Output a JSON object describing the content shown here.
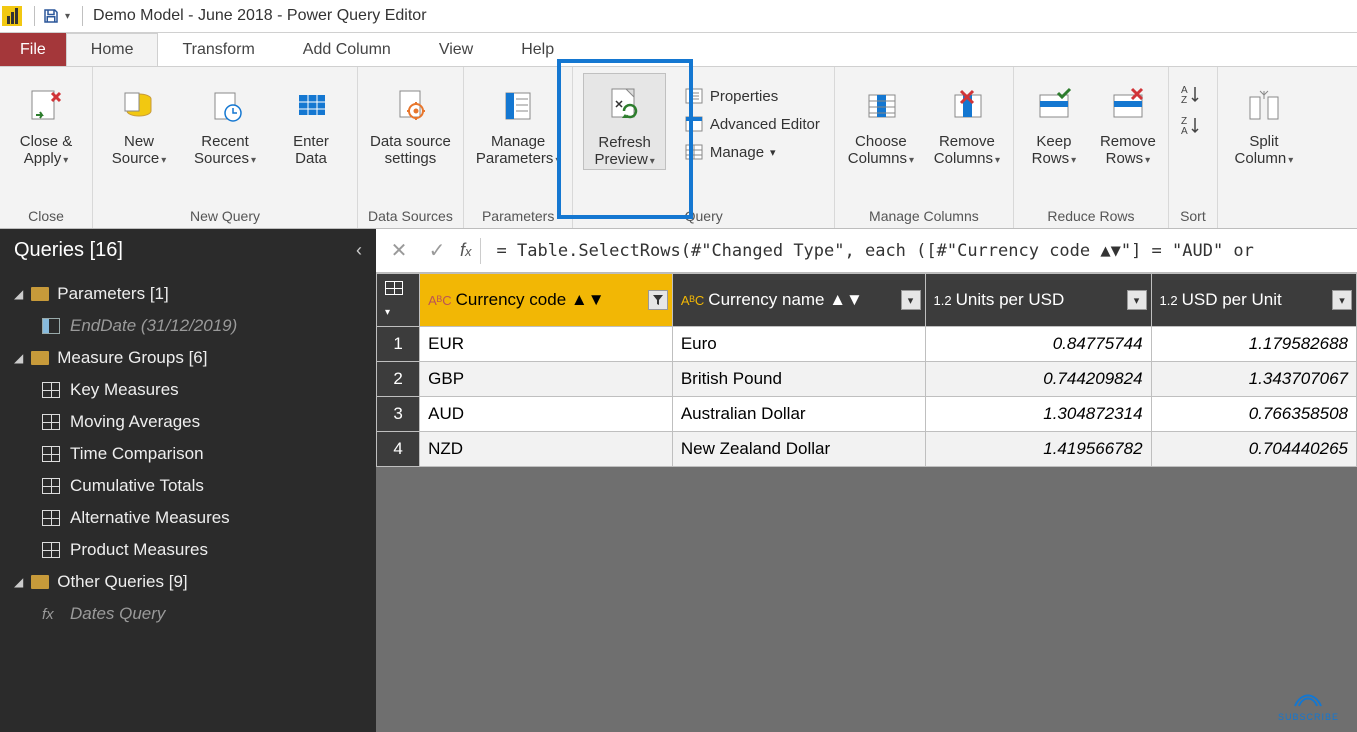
{
  "title": "Demo Model - June 2018 - Power Query Editor",
  "tabs": {
    "file": "File",
    "home": "Home",
    "transform": "Transform",
    "addcolumn": "Add Column",
    "view": "View",
    "help": "Help"
  },
  "ribbon": {
    "close_apply": "Close &\nApply",
    "close_group": "Close",
    "new_source": "New\nSource",
    "recent_sources": "Recent\nSources",
    "enter_data": "Enter\nData",
    "new_query_group": "New Query",
    "data_source_settings": "Data source\nsettings",
    "data_sources_group": "Data Sources",
    "manage_parameters": "Manage\nParameters",
    "parameters_group": "Parameters",
    "refresh_preview": "Refresh\nPreview",
    "properties": "Properties",
    "advanced_editor": "Advanced Editor",
    "manage": "Manage",
    "query_group": "Query",
    "choose_columns": "Choose\nColumns",
    "remove_columns": "Remove\nColumns",
    "manage_columns_group": "Manage Columns",
    "keep_rows": "Keep\nRows",
    "remove_rows": "Remove\nRows",
    "reduce_rows_group": "Reduce Rows",
    "sort_group": "Sort",
    "split_column": "Split\nColumn"
  },
  "sidebar": {
    "header": "Queries [16]",
    "groups": [
      {
        "label": "Parameters [1]",
        "items": [
          {
            "label": "EndDate (31/12/2019)",
            "type": "param",
            "dim": true
          }
        ]
      },
      {
        "label": "Measure Groups [6]",
        "items": [
          {
            "label": "Key Measures",
            "type": "table"
          },
          {
            "label": "Moving Averages",
            "type": "table"
          },
          {
            "label": "Time Comparison",
            "type": "table"
          },
          {
            "label": "Cumulative Totals",
            "type": "table"
          },
          {
            "label": "Alternative Measures",
            "type": "table"
          },
          {
            "label": "Product Measures",
            "type": "table"
          }
        ]
      },
      {
        "label": "Other Queries [9]",
        "items": [
          {
            "label": "Dates Query",
            "type": "fx",
            "dim": true
          }
        ]
      }
    ]
  },
  "formula": "= Table.SelectRows(#\"Changed Type\", each ([#\"Currency code ▲▼\"] = \"AUD\" or",
  "columns": {
    "code": "Currency code ▲▼",
    "name": "Currency name ▲▼",
    "upd": "Units per USD",
    "usdpu": "USD per Unit",
    "type_text": "AᴮC",
    "type_num": "1.2"
  },
  "rows": [
    {
      "n": "1",
      "code": "EUR",
      "name": "Euro",
      "upd": "0.84775744",
      "usdpu": "1.179582688"
    },
    {
      "n": "2",
      "code": "GBP",
      "name": "British Pound",
      "upd": "0.744209824",
      "usdpu": "1.343707067"
    },
    {
      "n": "3",
      "code": "AUD",
      "name": "Australian Dollar",
      "upd": "1.304872314",
      "usdpu": "0.766358508"
    },
    {
      "n": "4",
      "code": "NZD",
      "name": "New Zealand Dollar",
      "upd": "1.419566782",
      "usdpu": "0.704440265"
    }
  ],
  "subscribe": "SUBSCRIBE"
}
